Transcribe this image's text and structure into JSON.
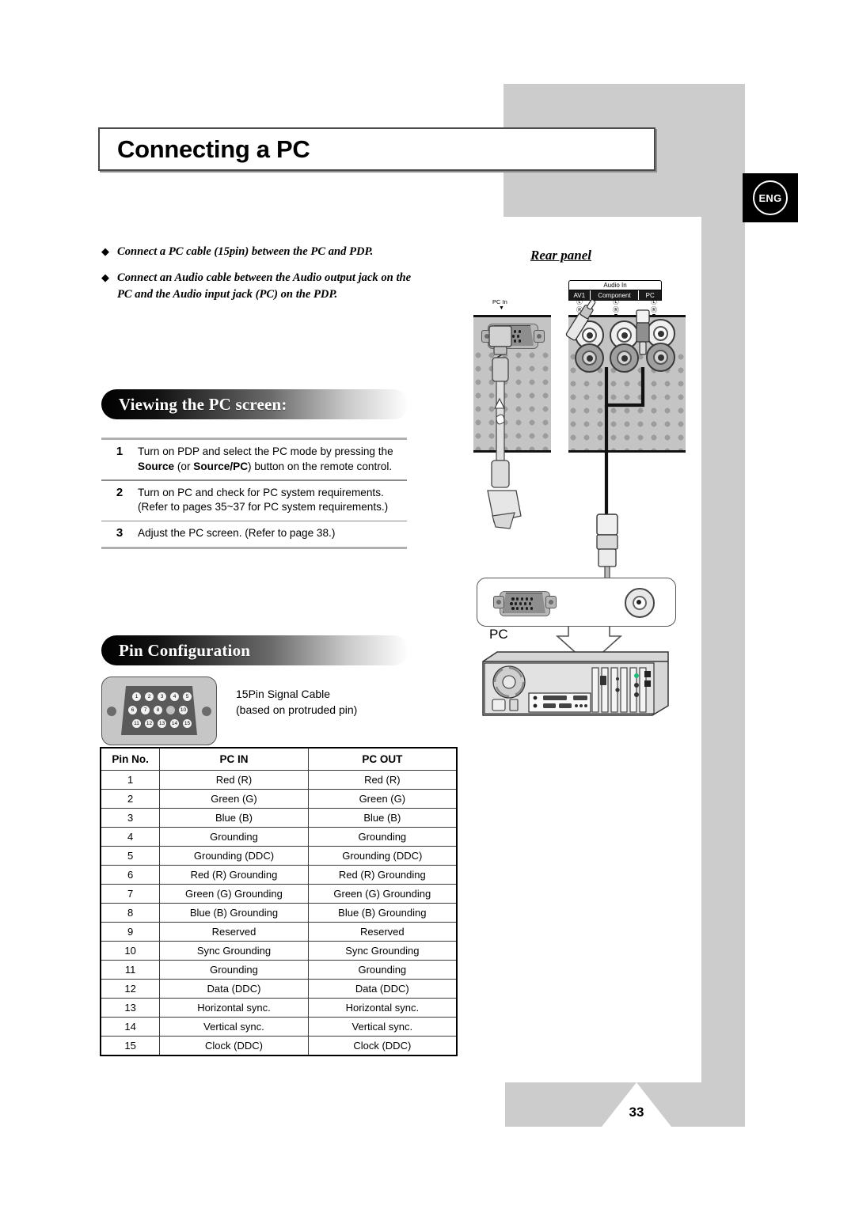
{
  "page": {
    "title": "Connecting a PC",
    "language_badge": "ENG",
    "page_number": "33"
  },
  "bullets": [
    {
      "marker": "◆",
      "text": "Connect a PC cable (15pin) between the PC and PDP."
    },
    {
      "marker": "◆",
      "text": "Connect an Audio cable between the Audio output jack on the PC and the Audio input jack (PC) on the PDP."
    }
  ],
  "sections": {
    "viewing": {
      "heading": "Viewing the PC screen:"
    },
    "pin": {
      "heading": "Pin Configuration"
    }
  },
  "steps": [
    {
      "num": "1",
      "parts": [
        {
          "t": "Turn on PDP and select the PC mode by pressing the ",
          "b": false
        },
        {
          "t": "Source",
          "b": true
        },
        {
          "t": " (or ",
          "b": false
        },
        {
          "t": "Source/PC",
          "b": true
        },
        {
          "t": ") button on the remote control.",
          "b": false
        }
      ]
    },
    {
      "num": "2",
      "parts": [
        {
          "t": "Turn on PC and check for PC system requirements. (Refer to pages 35~37 for PC system requirements.)",
          "b": false
        }
      ]
    },
    {
      "num": "3",
      "parts": [
        {
          "t": "Adjust the PC screen. (Refer to page 38.)",
          "b": false
        }
      ]
    }
  ],
  "connector": {
    "caption_line1": "15Pin Signal Cable",
    "caption_line2": "(based on protruded pin)",
    "pin_labels_row1": [
      "1",
      "2",
      "3",
      "4",
      "5"
    ],
    "pin_labels_row2": [
      "6",
      "7",
      "8",
      "",
      "10"
    ],
    "pin_labels_row3": [
      "11",
      "12",
      "13",
      "14",
      "15"
    ]
  },
  "pin_table": {
    "headers": [
      "Pin No.",
      "PC IN",
      "PC OUT"
    ],
    "rows": [
      [
        "1",
        "Red (R)",
        "Red (R)"
      ],
      [
        "2",
        "Green (G)",
        "Green (G)"
      ],
      [
        "3",
        "Blue (B)",
        "Blue (B)"
      ],
      [
        "4",
        "Grounding",
        "Grounding"
      ],
      [
        "5",
        "Grounding (DDC)",
        "Grounding (DDC)"
      ],
      [
        "6",
        "Red (R) Grounding",
        "Red (R) Grounding"
      ],
      [
        "7",
        "Green (G) Grounding",
        "Green (G) Grounding"
      ],
      [
        "8",
        "Blue (B) Grounding",
        "Blue (B) Grounding"
      ],
      [
        "9",
        "Reserved",
        "Reserved"
      ],
      [
        "10",
        "Sync Grounding",
        "Sync Grounding"
      ],
      [
        "11",
        "Grounding",
        "Grounding"
      ],
      [
        "12",
        "Data (DDC)",
        "Data (DDC)"
      ],
      [
        "13",
        "Horizontal sync.",
        "Horizontal sync."
      ],
      [
        "14",
        "Vertical sync.",
        "Vertical sync."
      ],
      [
        "15",
        "Clock (DDC)",
        "Clock (DDC)"
      ]
    ]
  },
  "diagram": {
    "title": "Rear panel",
    "pc_in_label": "PC In",
    "audio_in_title": "Audio In",
    "audio_in_columns": [
      "AV1",
      "Component",
      "PC"
    ],
    "lr_left": "Ⓛ",
    "lr_right": "Ⓡ",
    "pc_label": "PC"
  },
  "colors": {
    "gray_frame": "#cccccc",
    "panel": "#c4c4c4",
    "badge_bg": "#000000",
    "rule": "#b0b0b0"
  }
}
